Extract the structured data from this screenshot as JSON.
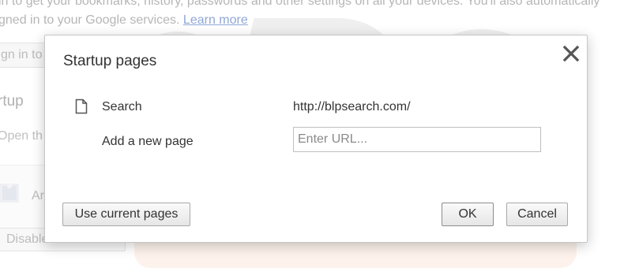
{
  "background": {
    "line1": "in to get your bookmarks, history, passwords and other settings on all your devices. You'll also automatically",
    "line2_prefix": "gned in to your Google services.",
    "learn_more": "Learn more",
    "signin_button": "gn in to",
    "startup_heading": "rtup",
    "open_text": "Open th",
    "extension_label": "Ar",
    "disable_button": "Disable extension"
  },
  "dialog": {
    "title": "Startup pages",
    "pages": [
      {
        "icon": "page-icon",
        "name": "Search",
        "url": "http://blpsearch.com/"
      }
    ],
    "add_label": "Add a new page",
    "url_placeholder": "Enter URL...",
    "buttons": {
      "use_current": "Use current pages",
      "ok": "OK",
      "cancel": "Cancel"
    }
  },
  "colors": {
    "link": "#8fa7d6",
    "dialog_border": "#c6c6c6",
    "text": "#333333"
  }
}
